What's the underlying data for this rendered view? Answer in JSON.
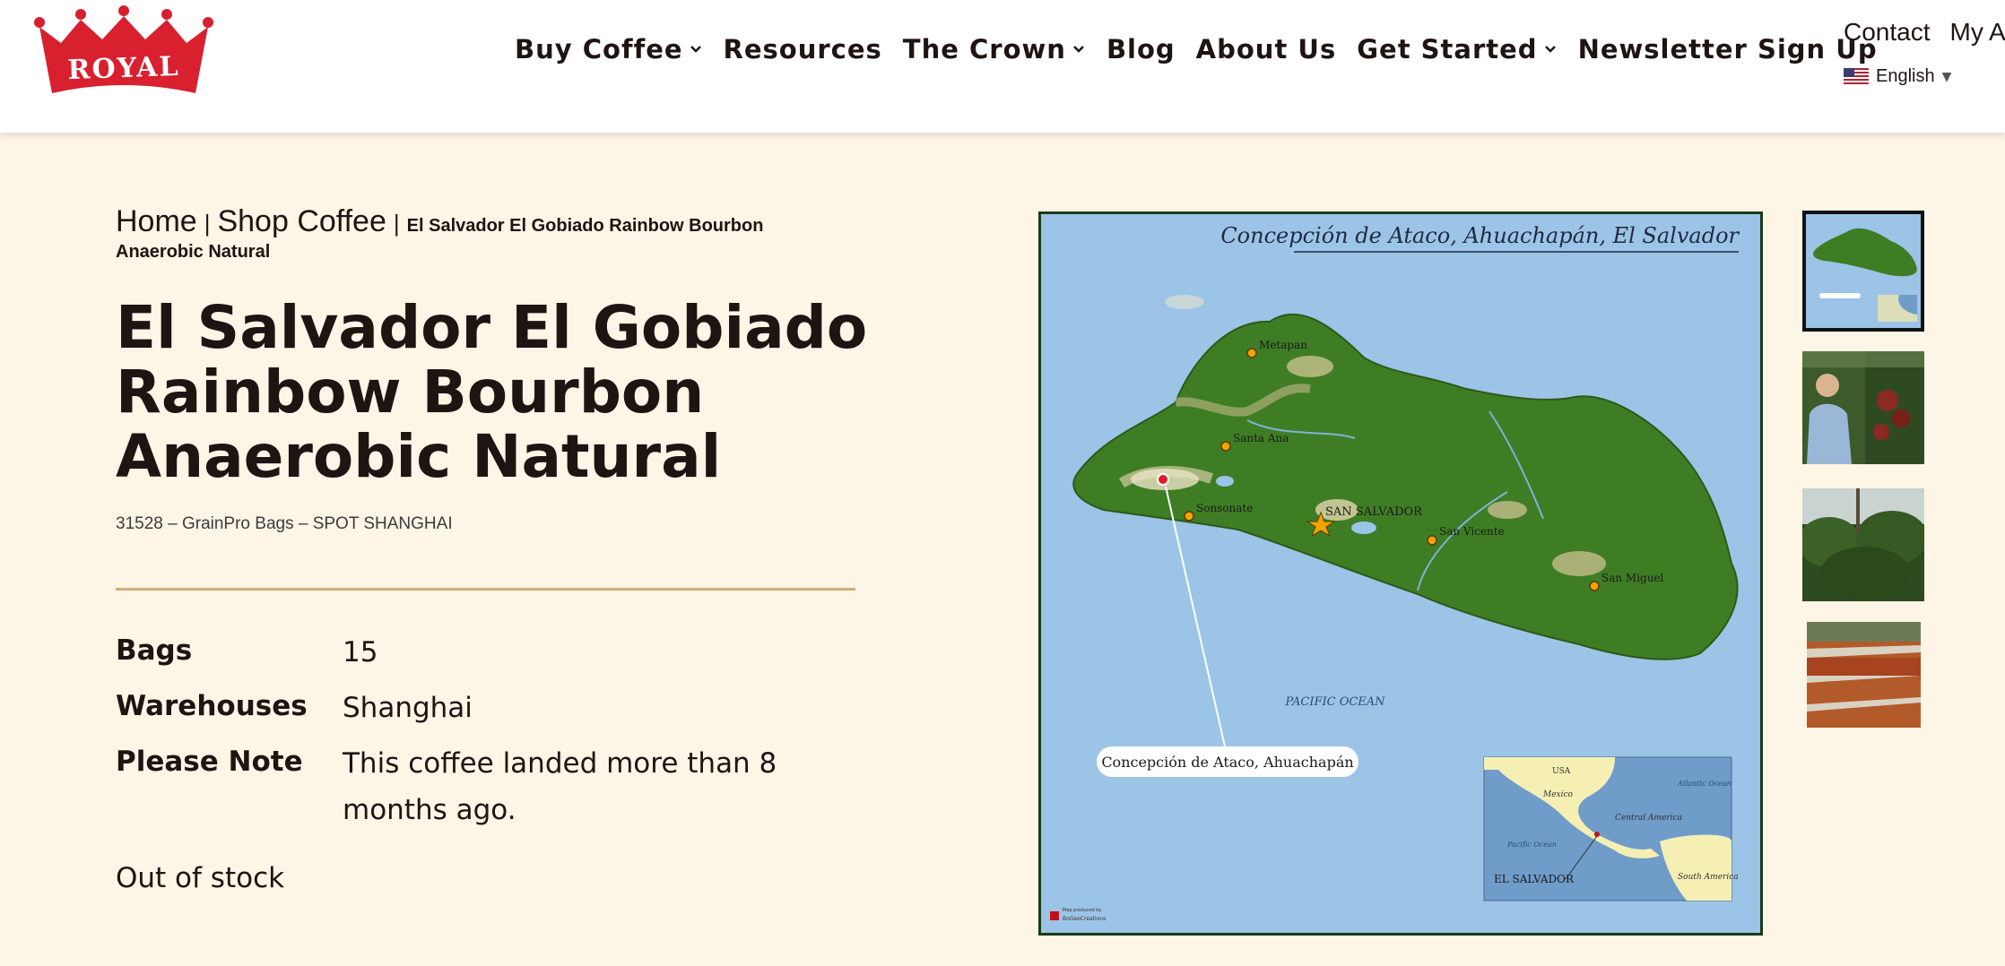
{
  "header": {
    "logo_text": "ROYAL",
    "nav": [
      {
        "label": "Buy Coffee",
        "has_dropdown": true
      },
      {
        "label": "Resources",
        "has_dropdown": false
      },
      {
        "label": "The Crown",
        "has_dropdown": true
      },
      {
        "label": "Blog",
        "has_dropdown": false
      },
      {
        "label": "About Us",
        "has_dropdown": false
      },
      {
        "label": "Get Started",
        "has_dropdown": true
      },
      {
        "label": "Newsletter Sign Up",
        "has_dropdown": false
      }
    ],
    "utility_links": [
      "Contact",
      "My Ac"
    ],
    "language": {
      "label": "English",
      "flag_icon": "us-flag-icon"
    }
  },
  "breadcrumb": {
    "home": "Home",
    "shop": "Shop Coffee",
    "current": "El Salvador El Gobiado Rainbow Bourbon Anaerobic Natural",
    "separator": "|"
  },
  "product": {
    "title": "El Salvador El Gobiado Rainbow Bourbon Anaerobic Natural",
    "subtitle": "31528 – GrainPro Bags – SPOT SHANGHAI",
    "specs": [
      {
        "label": "Bags",
        "value": "15"
      },
      {
        "label": "Warehouses",
        "value": "Shanghai"
      },
      {
        "label": "Please Note",
        "value": "This coffee landed more than 8 months ago."
      }
    ],
    "stock_status": "Out of stock"
  },
  "map": {
    "title": "Concepción de Ataco, Ahuachapán, El Salvador",
    "callout": "Concepción de Ataco, Ahuachapán",
    "ocean_label": "PACIFIC OCEAN",
    "cities": [
      "Metapan",
      "Santa Ana",
      "Sonsonate",
      "SAN SALVADOR",
      "San Vicente",
      "San Miguel"
    ],
    "inset_labels": [
      "USA",
      "Mexico",
      "Atlantic Ocean",
      "Central America",
      "Pacific Ocean",
      "EL SALVADOR",
      "South America"
    ],
    "credit": [
      "Map produced by",
      "BoGeoCreations"
    ]
  },
  "colors": {
    "page_bg": "#fdf5e6",
    "header_bg": "#ffffff",
    "text": "#1e1412",
    "rule": "#d2ae7a",
    "logo_red": "#d8202f",
    "map_water": "#9cc4e6",
    "map_land": "#3f7d24"
  }
}
